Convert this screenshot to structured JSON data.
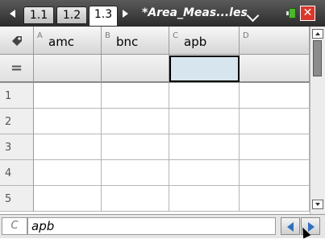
{
  "tabs": [
    {
      "label": "1.1",
      "active": false
    },
    {
      "label": "1.2",
      "active": false
    },
    {
      "label": "1.3",
      "active": true
    }
  ],
  "document_title": "*Area_Meas...les",
  "close_label": "✕",
  "columns": [
    {
      "letter": "A",
      "name": "amc"
    },
    {
      "letter": "B",
      "name": "bnc"
    },
    {
      "letter": "C",
      "name": "apb"
    },
    {
      "letter": "D",
      "name": ""
    }
  ],
  "formula_row_symbol": "=",
  "row_numbers": [
    "1",
    "2",
    "3",
    "4",
    "5"
  ],
  "entry_line": {
    "cell_ref": "C",
    "text": "apb"
  },
  "icons": {
    "tag": "tag-icon",
    "left": "nav-left-icon",
    "right": "nav-right-icon",
    "battery": "battery-icon",
    "menu": "chevron-down-icon"
  },
  "colors": {
    "selection_fill": "#d7e5ee",
    "close_red": "#d9382b",
    "nav_blue": "#2f6fc0"
  }
}
